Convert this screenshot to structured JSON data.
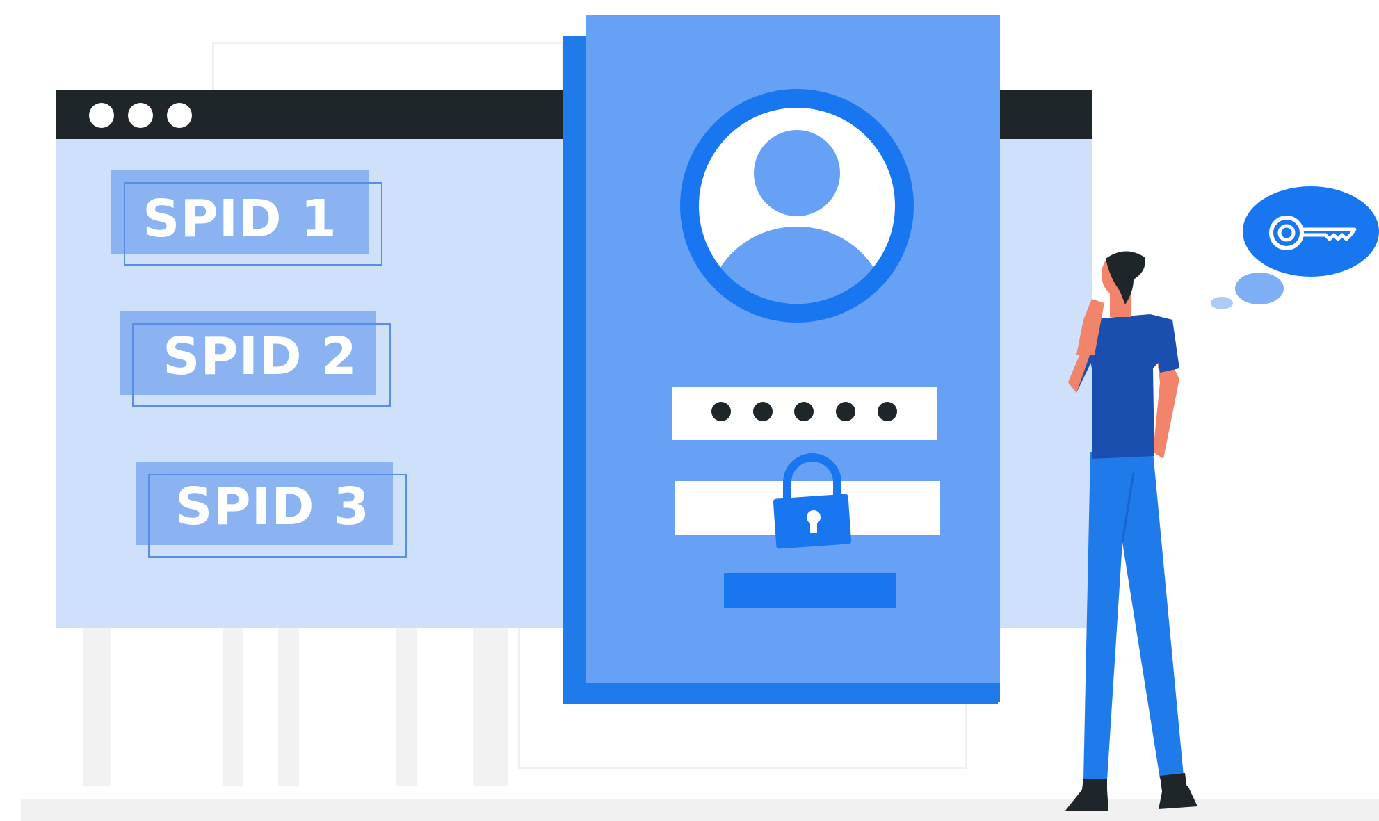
{
  "spid_options": [
    {
      "label": "SPID 1"
    },
    {
      "label": "SPID 2"
    },
    {
      "label": "SPID 3"
    }
  ],
  "login_card": {
    "avatar_icon": "user-avatar-icon",
    "password_mask": "•••••",
    "lock_icon": "padlock-icon"
  },
  "thought": {
    "icon": "key-icon"
  },
  "colors": {
    "primary_blue": "#1877f0",
    "card_blue": "#66a1f5",
    "window_blue": "#cfe0fb",
    "dark": "#1f262a",
    "skin": "#f1846b",
    "shirt": "#1a4fb0"
  }
}
